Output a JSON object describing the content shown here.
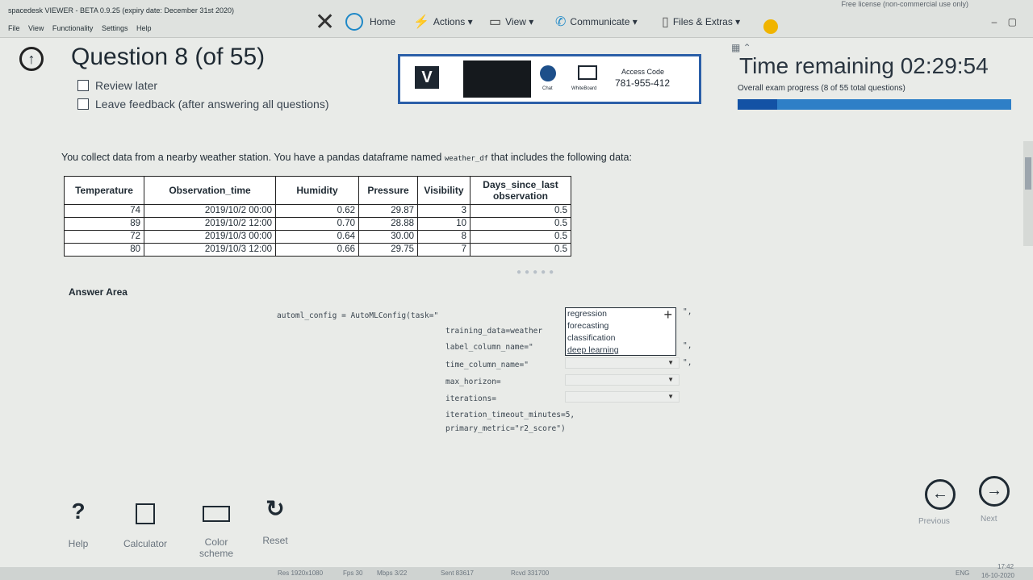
{
  "window": {
    "title": "spacedesk VIEWER - BETA 0.9.25 (expiry date: December 31st 2020)",
    "license": "Free license (non-commercial use only)",
    "menu": [
      "File",
      "View",
      "Functionality",
      "Settings",
      "Help"
    ]
  },
  "toolbar": {
    "home": "Home",
    "actions": "Actions ▾",
    "view": "View ▾",
    "communicate": "Communicate ▾",
    "files": "Files & Extras ▾"
  },
  "question": {
    "title": "Question 8 (of 55)",
    "review_later": "Review later",
    "leave_feedback": "Leave feedback (after answering all questions)",
    "text_before": "You collect data from a nearby weather station. You have a pandas dataframe named ",
    "text_code": "weather_df",
    "text_after": " that includes the following data:"
  },
  "remote": {
    "chat_label": "Chat",
    "whiteboard_label": "WhiteBoard",
    "access_label": "Access Code",
    "access_code": "781-955-412"
  },
  "timer": {
    "label": "Time remaining 02:29:54",
    "progress_text": "Overall exam progress (8 of 55 total questions)",
    "progress_fraction": 0.145
  },
  "table": {
    "headers": [
      "Temperature",
      "Observation_time",
      "Humidity",
      "Pressure",
      "Visibility",
      "Days_since_last observation"
    ],
    "rows": [
      [
        "74",
        "2019/10/2 00:00",
        "0.62",
        "29.87",
        "3",
        "0.5"
      ],
      [
        "89",
        "2019/10/2 12:00",
        "0.70",
        "28.88",
        "10",
        "0.5"
      ],
      [
        "72",
        "2019/10/3 00:00",
        "0.64",
        "30.00",
        "8",
        "0.5"
      ],
      [
        "80",
        "2019/10/3 12:00",
        "0.66",
        "29.75",
        "7",
        "0.5"
      ]
    ]
  },
  "answer": {
    "title": "Answer Area",
    "line1": "automl_config = AutoMLConfig(task=\"",
    "line2": "training_data=weather",
    "line3": "label_column_name=\"",
    "line4": "time_column_name=\"",
    "line5": "max_horizon=",
    "line6": "iterations=",
    "line7": "iteration_timeout_minutes=5,",
    "line8": "primary_metric=\"r2_score\")",
    "close_quote": "\",",
    "task_options": [
      "regression",
      "forecasting",
      "classification",
      "deep learning"
    ]
  },
  "bottom": {
    "help": "Help",
    "calculator": "Calculator",
    "color_scheme": "Color scheme",
    "reset": "Reset",
    "previous": "Previous",
    "next": "Next"
  },
  "status": {
    "res": "Res 1920x1080",
    "fps": "Fps 30",
    "mbps": "Mbps 3/22",
    "sent": "Sent 83617",
    "rcvd": "Rcvd 331700",
    "lang": "ENG",
    "time": "17:42",
    "date": "16-10-2020"
  }
}
